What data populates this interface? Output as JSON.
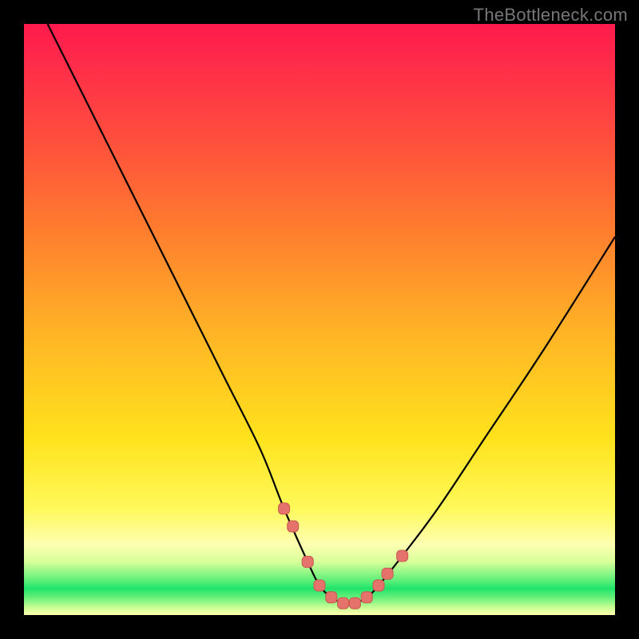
{
  "watermark": "TheBottleneck.com",
  "chart_data": {
    "type": "line",
    "title": "",
    "xlabel": "",
    "ylabel": "",
    "xlim": [
      0,
      100
    ],
    "ylim": [
      0,
      100
    ],
    "series": [
      {
        "name": "bottleneck-curve",
        "x": [
          4,
          10,
          16,
          22,
          28,
          34,
          40,
          44,
          48,
          50,
          52,
          54,
          56,
          58,
          60,
          64,
          70,
          78,
          88,
          100
        ],
        "values": [
          100,
          88,
          76,
          64,
          52,
          40,
          28,
          18,
          9,
          5,
          3,
          2,
          2,
          3,
          5,
          10,
          18,
          30,
          45,
          64
        ]
      }
    ],
    "markers": {
      "name": "highlighted-points",
      "x": [
        44,
        45.5,
        48,
        50,
        52,
        54,
        56,
        58,
        60,
        61.5,
        64
      ],
      "values": [
        18,
        15,
        9,
        5,
        3,
        2,
        2,
        3,
        5,
        7,
        10
      ]
    },
    "gradient_stops": [
      {
        "pos": 0,
        "color": "#ff1a4d"
      },
      {
        "pos": 0.5,
        "color": "#ffb326"
      },
      {
        "pos": 0.85,
        "color": "#fff95a"
      },
      {
        "pos": 0.95,
        "color": "#20e36a"
      },
      {
        "pos": 1.0,
        "color": "#fdffb0"
      }
    ]
  }
}
